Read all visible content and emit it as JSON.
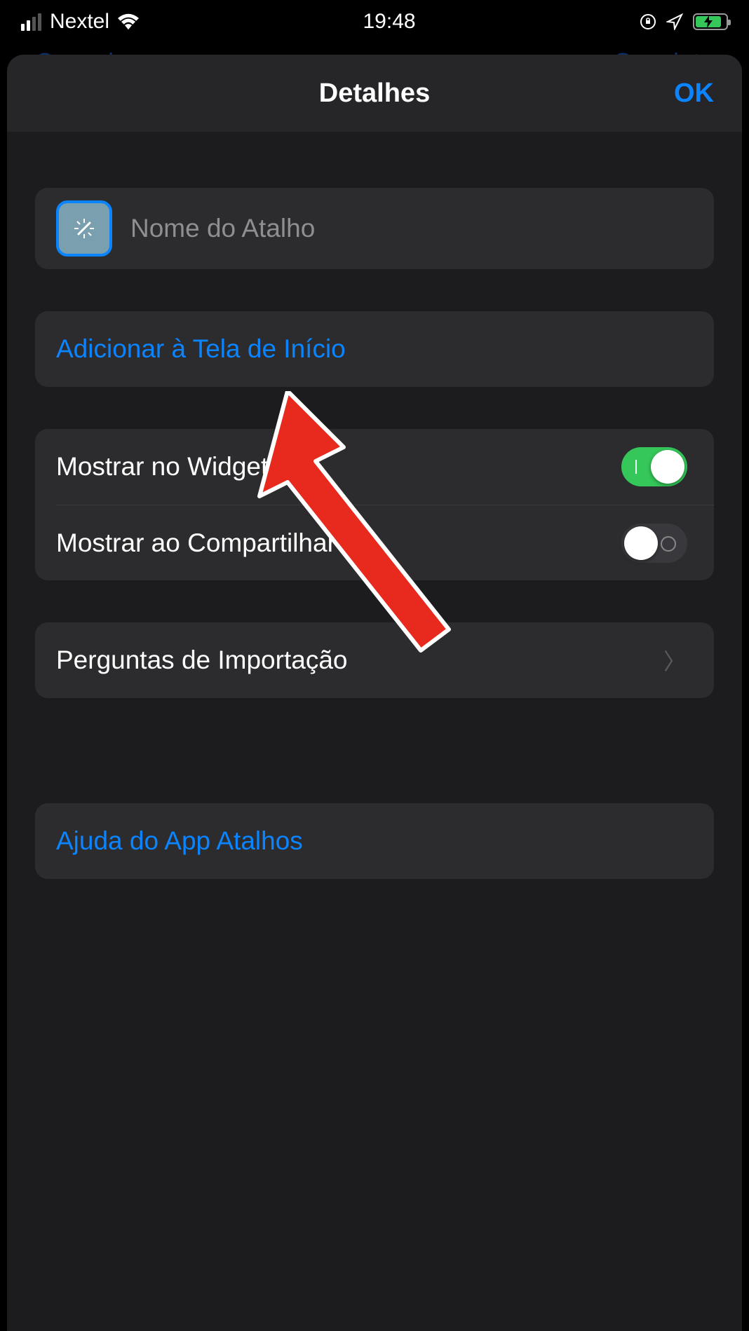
{
  "status_bar": {
    "carrier": "Nextel",
    "time": "19:48"
  },
  "background_nav": {
    "cancel": "Cancelar",
    "next": "Seguinte"
  },
  "modal": {
    "title": "Detalhes",
    "ok": "OK"
  },
  "shortcut": {
    "name_placeholder": "Nome do Atalho"
  },
  "actions": {
    "add_to_home": "Adicionar à Tela de Início"
  },
  "toggles": {
    "show_in_widget": {
      "label": "Mostrar no Widget",
      "on": true
    },
    "show_in_share": {
      "label": "Mostrar ao Compartilhar",
      "on": false
    }
  },
  "import_questions": "Perguntas de Importação",
  "help": "Ajuda do App Atalhos"
}
